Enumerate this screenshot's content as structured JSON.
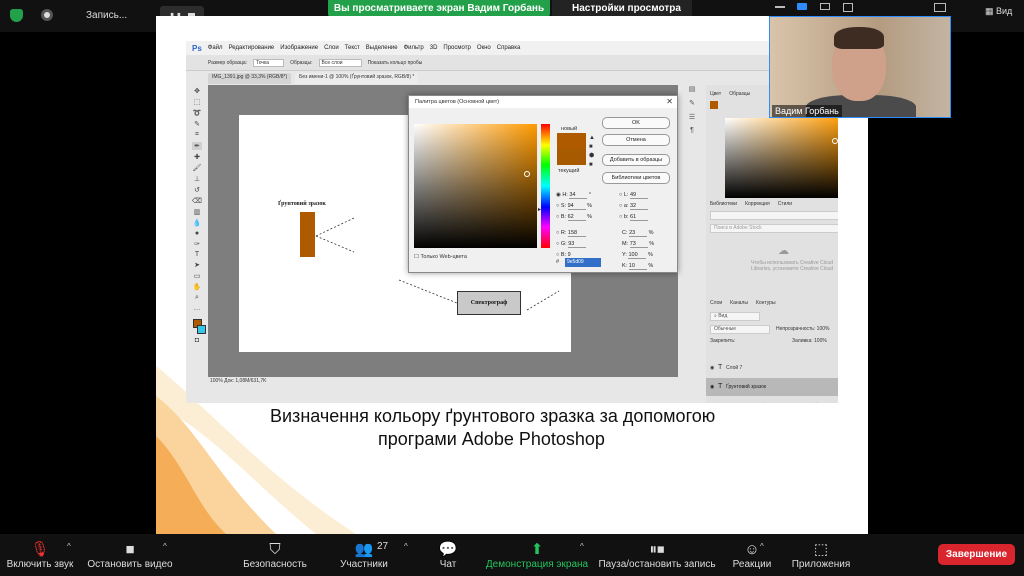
{
  "topbar": {
    "recording_label": "Запись...",
    "share_banner": "Вы просматриваете экран Вадим Горбань",
    "view_options": "Настройки просмотра",
    "view_button": "Вид"
  },
  "webcam": {
    "name": "Вадим Горбань"
  },
  "photoshop": {
    "logo": "Ps",
    "menu": [
      "Файл",
      "Редактирование",
      "Изображение",
      "Слои",
      "Текст",
      "Выделение",
      "Фильтр",
      "3D",
      "Просмотр",
      "Окно",
      "Справка"
    ],
    "options": [
      "Размер образца:",
      "Точка",
      "Образцы:",
      "Все слои",
      "Показать кольцо пробы"
    ],
    "tabs": [
      "IMG_1391.jpg @ 33,3% (RGB/8*)",
      "Без имени-1 @ 100% (Ґрунтовий зразок, RGB/8) *"
    ],
    "status": "100%     Док: 1,08M/631,7K",
    "canvas": {
      "sample_label": "Ґрунтовий зразок",
      "spectro_label": "Спектрограф"
    },
    "picker": {
      "title": "Палитра цветов (Основной цвет)",
      "label_new": "новый",
      "label_current": "текущий",
      "buttons": {
        "ok": "OK",
        "cancel": "Отмена",
        "add": "Добавить в образцы",
        "libraries": "Библиотеки цветов"
      },
      "web_only": "Только Web-цвета",
      "H": "34",
      "S": "94",
      "Bv": "62",
      "R": "158",
      "G": "93",
      "B": "9",
      "L": "49",
      "a": "32",
      "b": "61",
      "C": "23",
      "M": "73",
      "Y": "100",
      "K": "10",
      "hex": "9e5d09",
      "unit_deg": "°",
      "unit_pct": "%"
    },
    "panels": {
      "color_tabs": [
        "Цвет",
        "Образцы"
      ],
      "lib_tabs": [
        "Библиотеки",
        "Коррекция",
        "Стили"
      ],
      "lib_search": "Поиск в Adobe Stock",
      "lib_message": "Чтобы использовать Creative Cloud Libraries, установите Creative Cloud",
      "layer_tabs": [
        "Слои",
        "Каналы",
        "Контуры"
      ],
      "layer_kind": "Вид",
      "blend": "Обычные",
      "opacity_label": "Непрозрачность:",
      "opacity": "100%",
      "lock_label": "Закрепить:",
      "fill_label": "Заливка:",
      "fill": "100%",
      "layers": [
        "Слой 7",
        "Ґрунтовий зразок"
      ]
    }
  },
  "slide": {
    "caption_line1": "Визначення кольору ґрунтового зразка за допомогою",
    "caption_line2": "програми Adobe Photoshop"
  },
  "toolbar": {
    "unmute": "Включить звук",
    "video": "Остановить видео",
    "security": "Безопасность",
    "participants": "Участники",
    "participants_count": "27",
    "chat": "Чат",
    "share": "Демонстрация экрана",
    "pause_rec": "Пауза/остановить запись",
    "reactions": "Реакции",
    "apps": "Приложения",
    "end": "Завершение"
  },
  "colors": {
    "accent_green": "#23a04a",
    "end_red": "#d9262e",
    "sample": "#9e5d09"
  }
}
